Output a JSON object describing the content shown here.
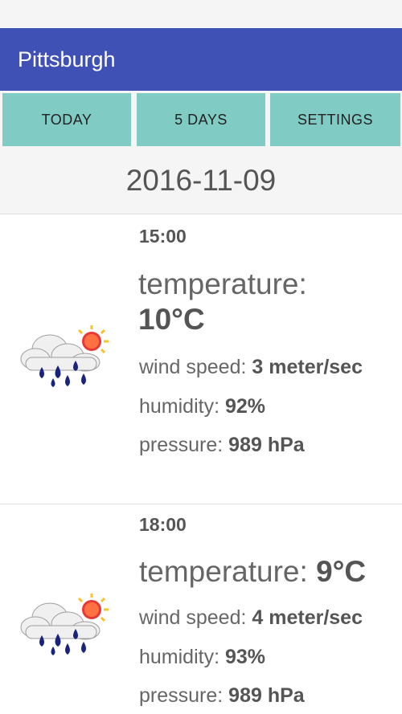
{
  "app": {
    "title": "Pittsburgh"
  },
  "tabs": [
    {
      "label": "TODAY"
    },
    {
      "label": "5 DAYS"
    },
    {
      "label": "SETTINGS"
    }
  ],
  "date": "2016-11-09",
  "forecasts": [
    {
      "time": "15:00",
      "temperature_label": "temperature:",
      "temperature_value": "10°C",
      "wind_label": "wind speed:",
      "wind_value": "3 meter/sec",
      "humidity_label": "humidity:",
      "humidity_value": "92%",
      "pressure_label": "pressure:",
      "pressure_value": "989 hPa",
      "icon": "rain-cloud-sun-icon"
    },
    {
      "time": "18:00",
      "temperature_label": "temperature:",
      "temperature_value": "9°C",
      "wind_label": "wind speed:",
      "wind_value": "4 meter/sec",
      "humidity_label": "humidity:",
      "humidity_value": "93%",
      "pressure_label": "pressure:",
      "pressure_value": "989 hPa",
      "icon": "rain-cloud-sun-icon"
    }
  ],
  "colors": {
    "app_bar": "#3f51b5",
    "tab": "#80cbc4",
    "background": "#f5f5f5"
  }
}
